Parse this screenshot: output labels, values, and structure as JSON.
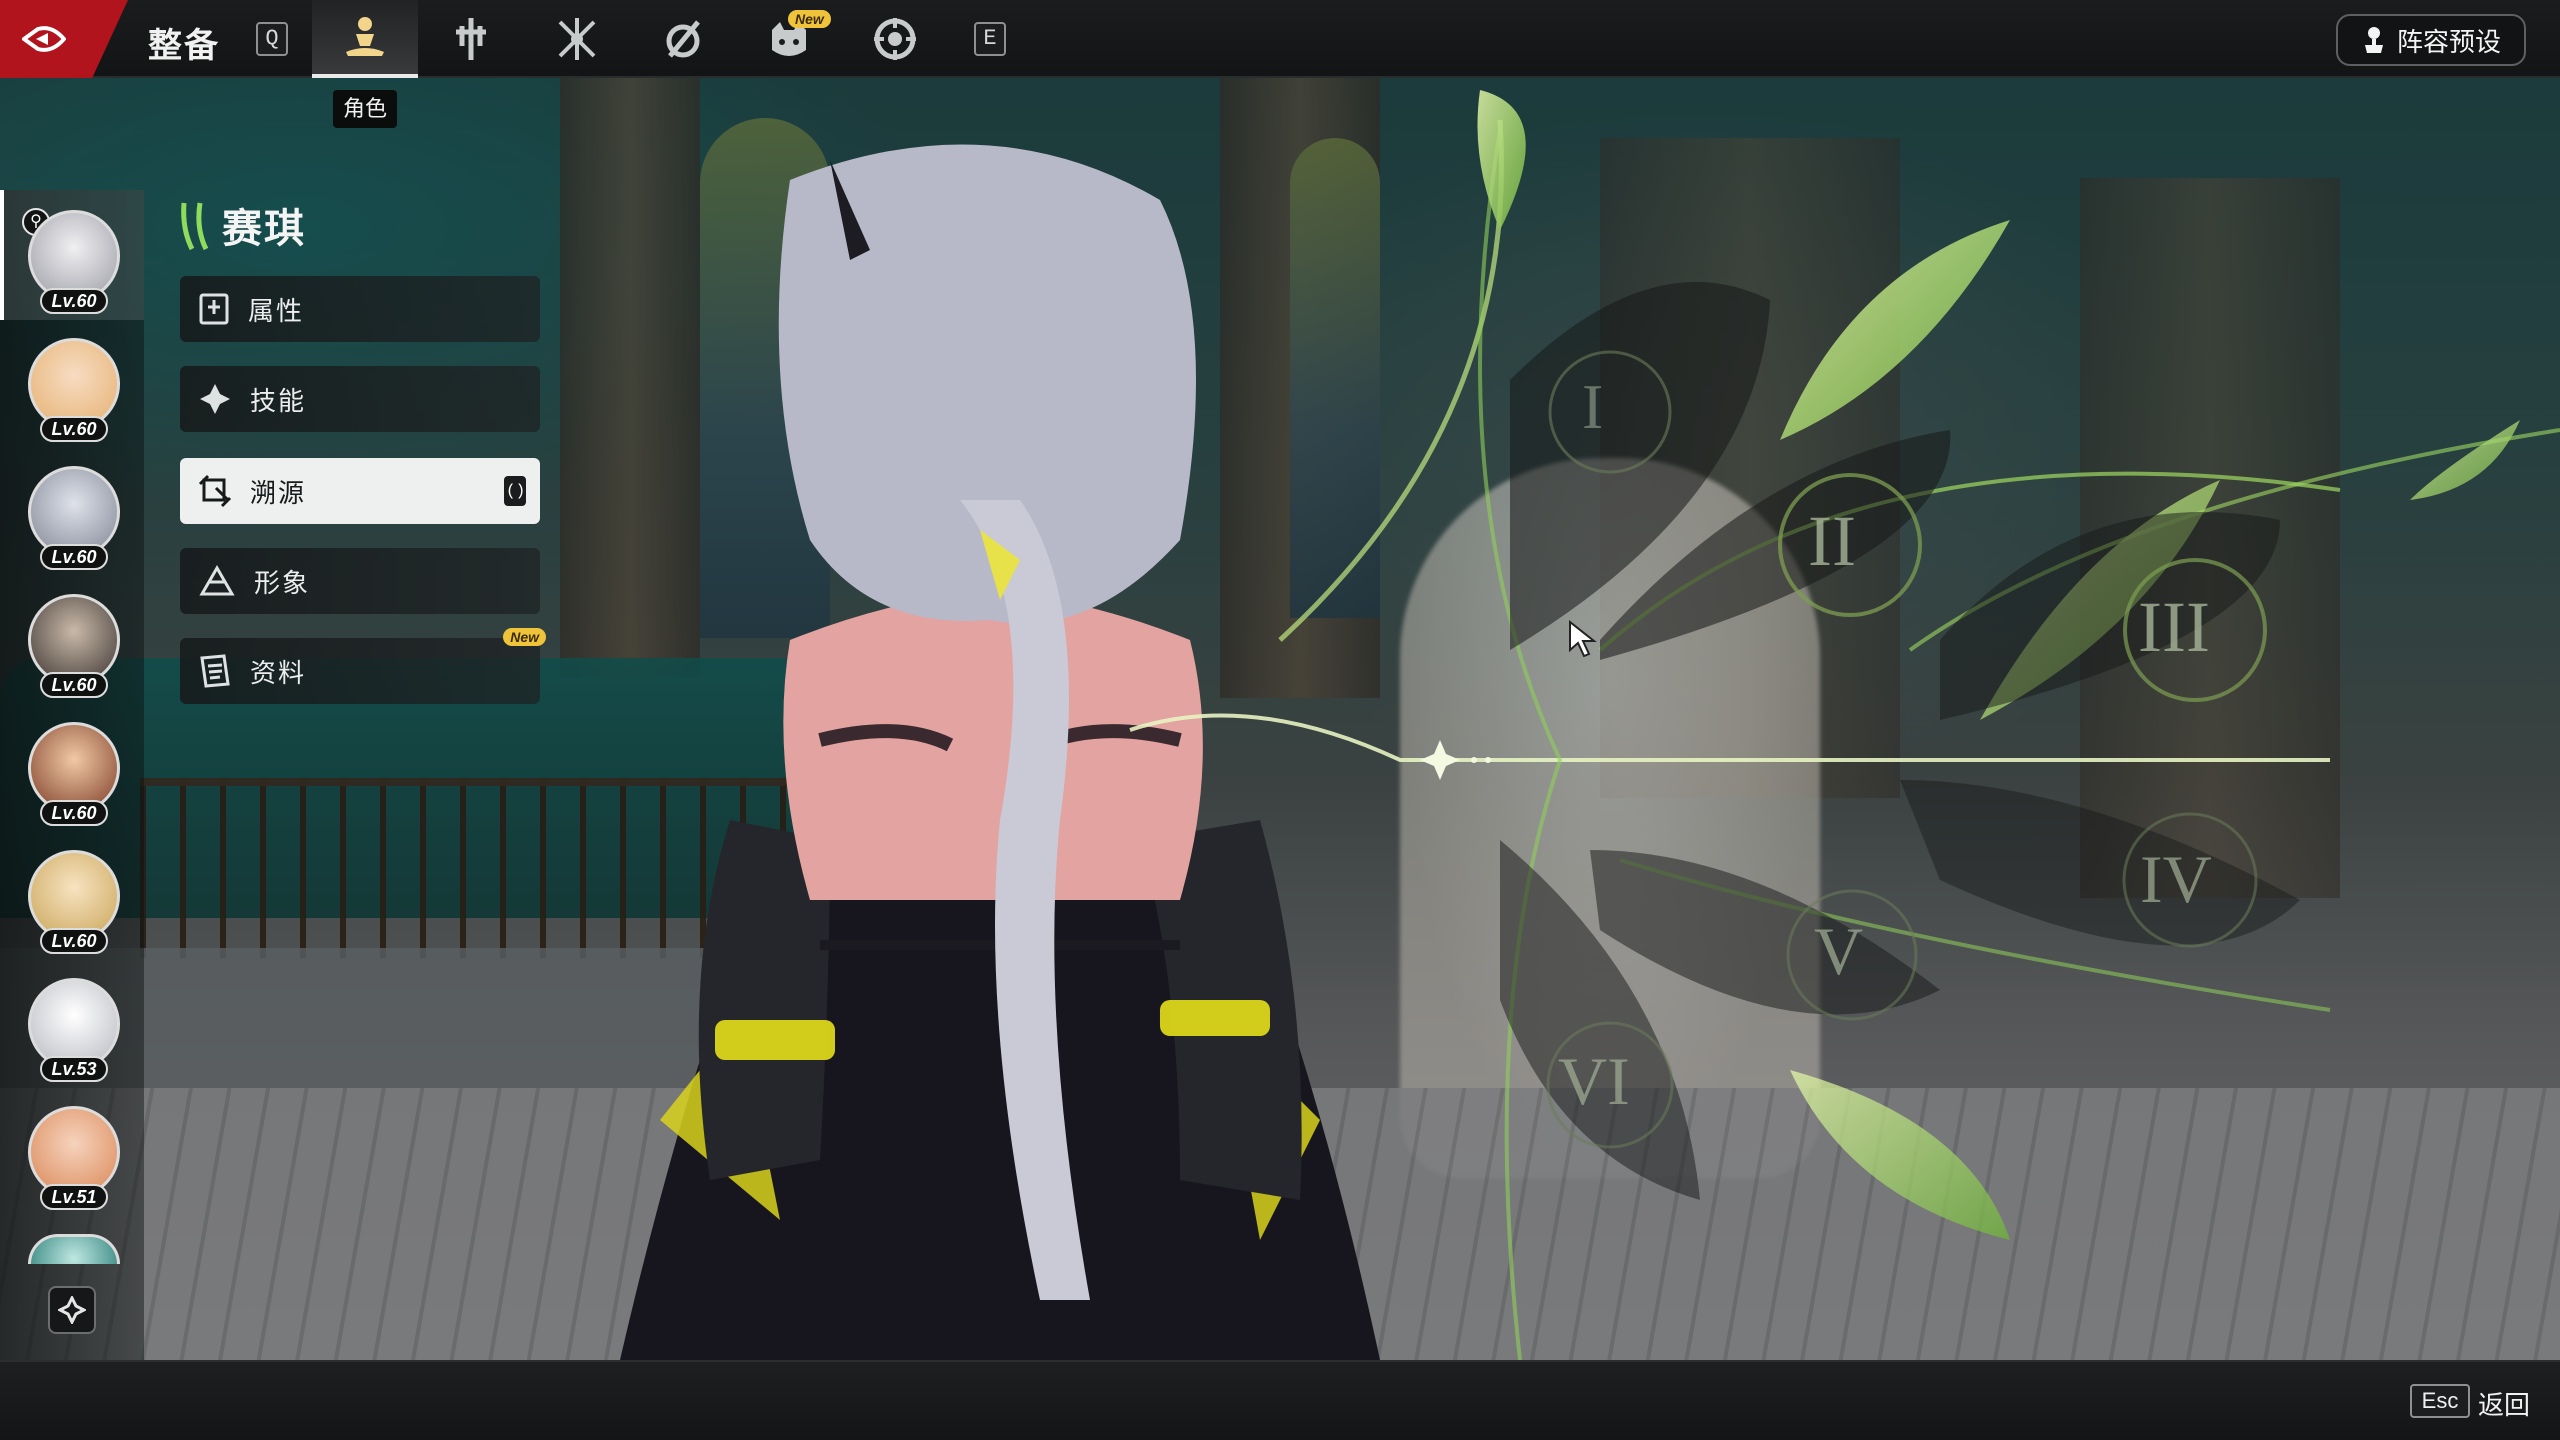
{
  "topbar": {
    "title": "整备",
    "key_left": "Q",
    "key_right": "E",
    "tabs": [
      {
        "icon": "character-icon",
        "active": true
      },
      {
        "icon": "weapon-icon",
        "active": false
      },
      {
        "icon": "matrix-icon",
        "active": false
      },
      {
        "icon": "relic-icon",
        "active": false
      },
      {
        "icon": "pet-icon",
        "active": false,
        "badge": "New"
      },
      {
        "icon": "gear-icon",
        "active": false
      }
    ],
    "tooltip": "角色",
    "preset_label": "阵容预设"
  },
  "roster": {
    "characters": [
      {
        "level": "Lv.60",
        "selected": true
      },
      {
        "level": "Lv.60"
      },
      {
        "level": "Lv.60"
      },
      {
        "level": "Lv.60"
      },
      {
        "level": "Lv.60"
      },
      {
        "level": "Lv.60"
      },
      {
        "level": "Lv.53"
      },
      {
        "level": "Lv.51"
      }
    ]
  },
  "side_menu": {
    "character_name": "赛琪",
    "items": [
      {
        "label": "属性",
        "icon": "attributes-icon"
      },
      {
        "label": "技能",
        "icon": "skill-icon"
      },
      {
        "label": "溯源",
        "icon": "trace-icon",
        "active": true,
        "key": "()"
      },
      {
        "label": "形象",
        "icon": "appearance-icon"
      },
      {
        "label": "资料",
        "icon": "profile-icon",
        "badge": "New"
      }
    ]
  },
  "trace_nodes": [
    "I",
    "II",
    "III",
    "IV",
    "V",
    "VI"
  ],
  "bottombar": {
    "esc_key": "Esc",
    "esc_label": "返回"
  },
  "colors": {
    "accent_red": "#b2141d",
    "leaf_green": "#b6e36a",
    "badge_yellow": "#f0c43a"
  }
}
